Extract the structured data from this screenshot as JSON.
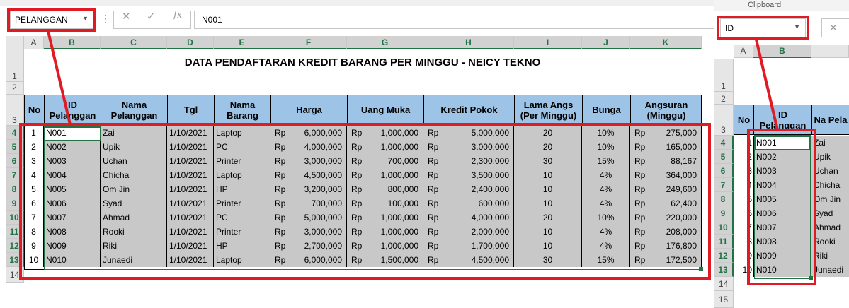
{
  "main": {
    "namebox": "PELANGGAN",
    "formula": "N001",
    "fx": "fx",
    "columns": [
      "A",
      "B",
      "C",
      "D",
      "E",
      "F",
      "G",
      "H",
      "I",
      "J",
      "K"
    ],
    "title": "DATA PENDAFTARAN KREDIT BARANG PER MINGGU - NEICY TEKNO",
    "headers": [
      "No",
      "ID Pelanggan",
      "Nama Pelanggan",
      "Tgl",
      "Nama Barang",
      "Harga",
      "Uang Muka",
      "Kredit Pokok",
      "Lama Angs (Per Minggu)",
      "Bunga",
      "Angsuran (Minggu)"
    ],
    "currency": "Rp",
    "rows": [
      [
        "1",
        "N001",
        "Zai",
        "1/10/2021",
        "Laptop",
        "6,000,000",
        "1,000,000",
        "5,000,000",
        "20",
        "10%",
        "275,000"
      ],
      [
        "2",
        "N002",
        "Upik",
        "1/10/2021",
        "PC",
        "4,000,000",
        "1,000,000",
        "3,000,000",
        "20",
        "10%",
        "165,000"
      ],
      [
        "3",
        "N003",
        "Uchan",
        "1/10/2021",
        "Printer",
        "3,000,000",
        "700,000",
        "2,300,000",
        "30",
        "15%",
        "88,167"
      ],
      [
        "4",
        "N004",
        "Chicha",
        "1/10/2021",
        "Laptop",
        "4,500,000",
        "1,000,000",
        "3,500,000",
        "10",
        "4%",
        "364,000"
      ],
      [
        "5",
        "N005",
        "Om Jin",
        "1/10/2021",
        "HP",
        "3,200,000",
        "800,000",
        "2,400,000",
        "10",
        "4%",
        "249,600"
      ],
      [
        "6",
        "N006",
        "Syad",
        "1/10/2021",
        "Printer",
        "700,000",
        "100,000",
        "600,000",
        "10",
        "4%",
        "62,400"
      ],
      [
        "7",
        "N007",
        "Ahmad",
        "1/10/2021",
        "PC",
        "5,000,000",
        "1,000,000",
        "4,000,000",
        "20",
        "10%",
        "220,000"
      ],
      [
        "8",
        "N008",
        "Rooki",
        "1/10/2021",
        "Printer",
        "3,000,000",
        "1,000,000",
        "2,000,000",
        "10",
        "4%",
        "208,000"
      ],
      [
        "9",
        "N009",
        "Riki",
        "1/10/2021",
        "HP",
        "2,700,000",
        "1,000,000",
        "1,700,000",
        "10",
        "4%",
        "176,800"
      ],
      [
        "10",
        "N010",
        "Junaedi",
        "1/10/2021",
        "Laptop",
        "6,000,000",
        "1,500,000",
        "4,500,000",
        "30",
        "15%",
        "172,500"
      ]
    ],
    "row_numbers": [
      "1",
      "2",
      "3",
      "4",
      "5",
      "6",
      "7",
      "8",
      "9",
      "10",
      "11",
      "12",
      "13",
      "14"
    ]
  },
  "side": {
    "clipboard_label": "Clipboard",
    "namebox": "ID",
    "columns": [
      "A",
      "B"
    ],
    "headers": [
      "No",
      "ID Pelanggan",
      "Na Pela"
    ],
    "row_numbers": [
      "1",
      "2",
      "3",
      "4",
      "5",
      "6",
      "7",
      "8",
      "9",
      "10",
      "11",
      "12",
      "13",
      "14",
      "15"
    ],
    "ids": [
      "N001",
      "N002",
      "N003",
      "N004",
      "N005",
      "N006",
      "N007",
      "N008",
      "N009",
      "N010"
    ],
    "nums": [
      "1",
      "2",
      "3",
      "4",
      "5",
      "6",
      "7",
      "8",
      "9",
      "10"
    ],
    "names": [
      "Zai",
      "Upik",
      "Uchan",
      "Chicha",
      "Om Jin",
      "Syad",
      "Ahmad",
      "Rooki",
      "Riki",
      "Junaedi"
    ]
  },
  "colors": {
    "header_fill": "#9dc3e6",
    "selection": "#c8c8c8",
    "highlight": "#e01b24",
    "excel_green": "#217346"
  }
}
